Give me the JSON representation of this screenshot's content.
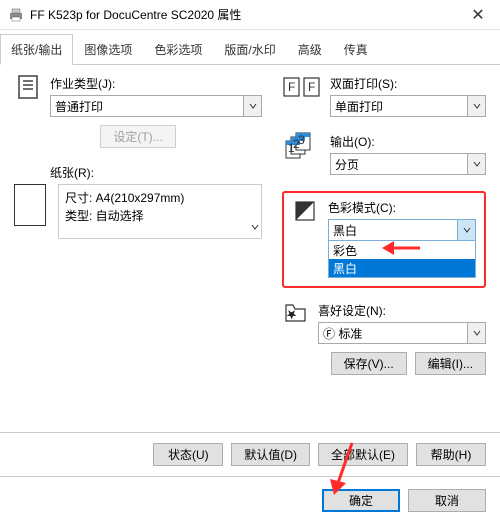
{
  "window": {
    "title": "FF K523p for DocuCentre SC2020 属性"
  },
  "tabs": {
    "t0": "纸张/输出",
    "t1": "图像选项",
    "t2": "色彩选项",
    "t3": "版面/水印",
    "t4": "高级",
    "t5": "传真"
  },
  "jobType": {
    "label": "作业类型(J):",
    "value": "普通打印",
    "settingsBtn": "设定(T)..."
  },
  "paper": {
    "label": "纸张(R):",
    "line1": "尺寸: A4(210x297mm)",
    "line2": "类型: 自动选择"
  },
  "duplex": {
    "label": "双面打印(S):",
    "value": "单面打印"
  },
  "output": {
    "label": "输出(O):",
    "value": "分页"
  },
  "colorMode": {
    "label": "色彩模式(C):",
    "value": "黑白",
    "opt0": "彩色",
    "opt1": "黑白"
  },
  "favorites": {
    "label": "喜好设定(N):",
    "prefix": "Ⓕ",
    "value": "标准",
    "saveBtn": "保存(V)...",
    "editBtn": "编辑(I)..."
  },
  "footerBtns": {
    "status": "状态(U)",
    "defaults": "默认值(D)",
    "allDefaults": "全部默认(E)",
    "help": "帮助(H)"
  },
  "mainBtns": {
    "ok": "确定",
    "cancel": "取消"
  }
}
